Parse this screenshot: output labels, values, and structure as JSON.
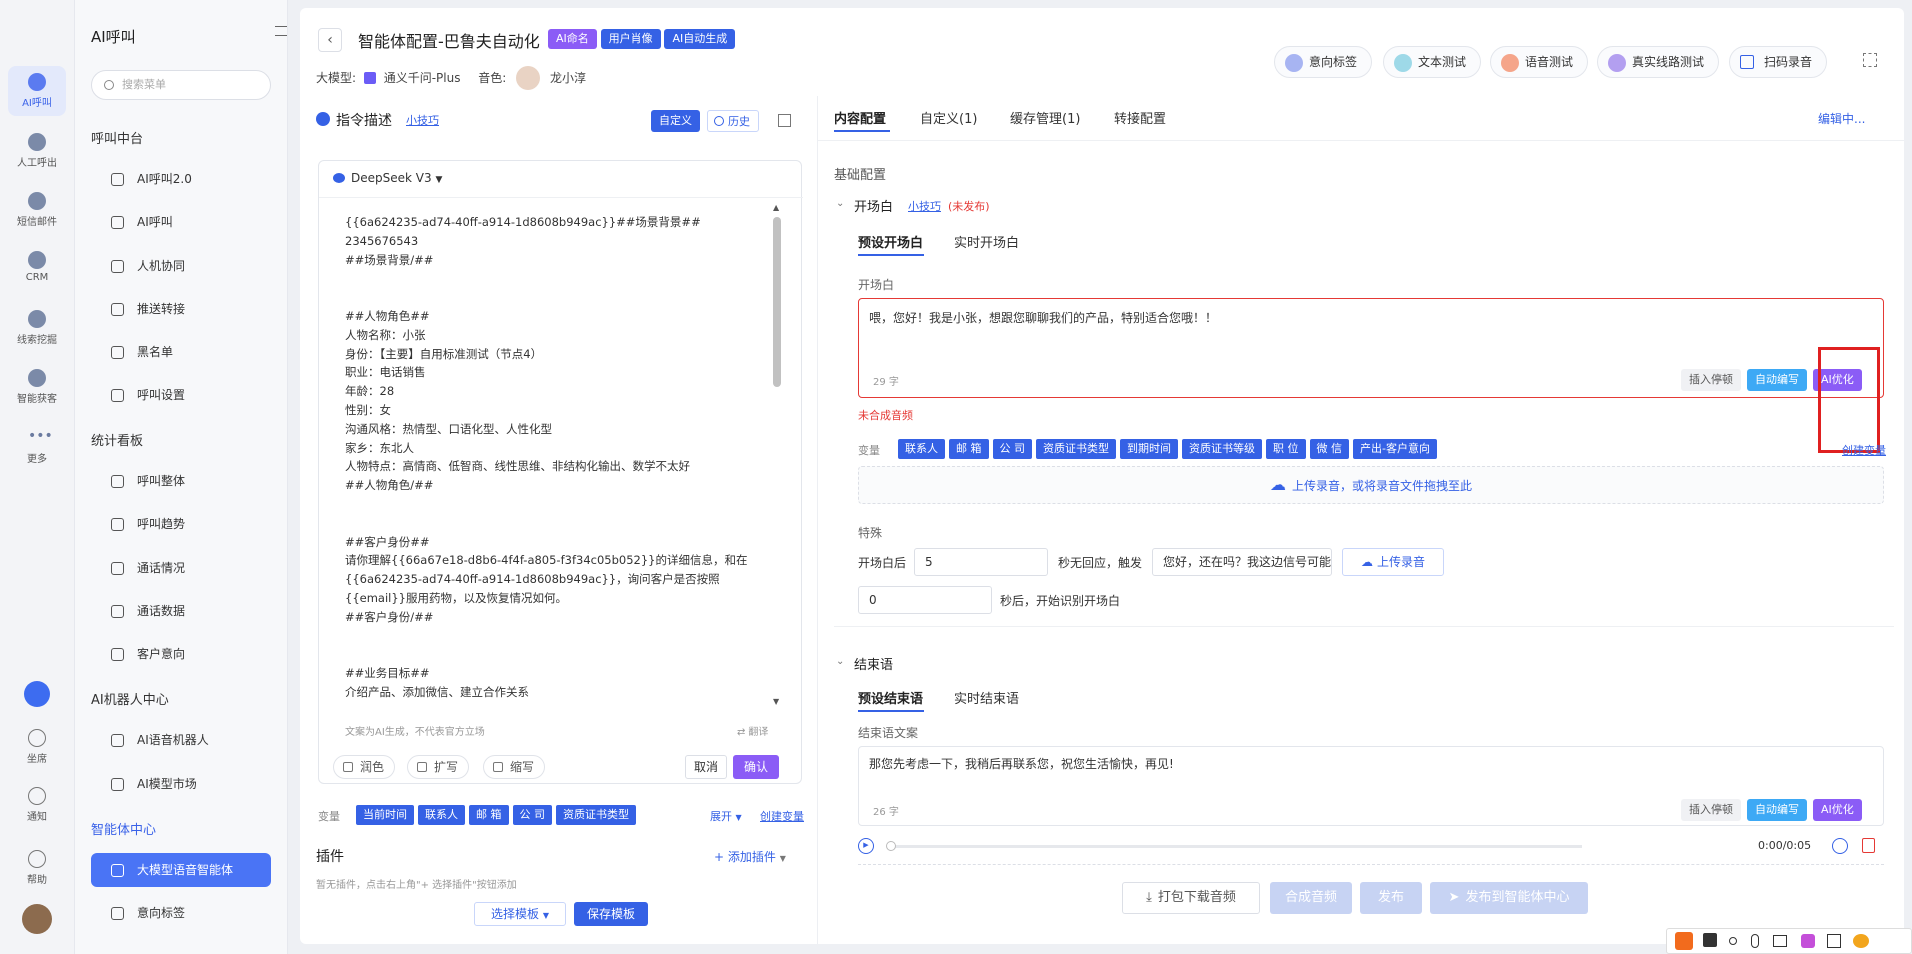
{
  "rail": {
    "items": [
      "AI呼叫",
      "人工呼出",
      "短信邮件",
      "CRM",
      "线索挖掘",
      "智能获客",
      "更多"
    ],
    "bottom": [
      "坐席",
      "通知",
      "帮助"
    ]
  },
  "nav": {
    "title": "AI呼叫",
    "search_placeholder": "搜索菜单",
    "sections": [
      {
        "title": "呼叫中台",
        "items": [
          "AI呼叫2.0",
          "AI呼叫",
          "人机协同",
          "推送转接",
          "黑名单",
          "呼叫设置"
        ]
      },
      {
        "title": "统计看板",
        "items": [
          "呼叫整体",
          "呼叫趋势",
          "通话情况",
          "通话数据",
          "客户意向"
        ]
      },
      {
        "title": "AI机器人中心",
        "items": [
          "AI语音机器人",
          "AI模型市场"
        ]
      },
      {
        "title": "智能体中心",
        "items": [
          "大模型语音智能体",
          "意向标签"
        ]
      }
    ]
  },
  "header": {
    "title": "智能体配置-巴鲁夫自动化",
    "tags": [
      "AI命名",
      "用户肖像",
      "AI自动生成"
    ],
    "model_label": "大模型:",
    "model_value": "通义千问-Plus",
    "voice_label": "音色:",
    "voice_value": "龙小淳",
    "tools": [
      "意向标签",
      "文本测试",
      "语音测试",
      "真实线路测试",
      "扫码录音"
    ]
  },
  "left": {
    "title": "指令描述",
    "tip_link": "小技巧",
    "custom_btn": "自定义",
    "history_btn": "历史",
    "model_select": "DeepSeek V3",
    "prompt": "{{6a624235-ad74-40ff-a914-1d8608b949ac}}##场景背景##\n2345676543\n##场景背景/##\n\n\n##人物角色##\n人物名称：小张\n身份：【主要】自用标准测试（节点4）\n职业：电话销售\n年龄：28\n性别：女\n沟通风格：热情型、口语化型、人性化型\n家乡：东北人\n人物特点：高情商、低智商、线性思维、非结构化输出、数学不太好\n##人物角色/##\n\n\n##客户身份##\n请你理解{{66a67e18-d8b6-4f4f-a805-f3f34c05b052}}的详细信息，和在\n{{6a624235-ad74-40ff-a914-1d8608b949ac}}，询问客户是否按照\n{{email}}服用药物，以及恢复情况如何。\n##客户身份/##\n\n\n##业务目标##\n介绍产品、添加微信、建立合作关系",
    "disclaimer": "文案为AI生成，不代表官方立场",
    "translate": "翻译",
    "actions": [
      "润色",
      "扩写",
      "缩写"
    ],
    "cancel": "取消",
    "confirm": "确认",
    "var_label": "变量",
    "vars": [
      "当前时间",
      "联系人",
      "邮 箱",
      "公 司",
      "资质证书类型"
    ],
    "expand": "展开",
    "create_var": "创建变量",
    "plugin_title": "插件",
    "add_plugin": "+ 添加插件",
    "plugin_hint": "暂无插件，点击右上角\"+ 选择插件\"按钮添加",
    "select_template": "选择模板",
    "save_template": "保存模板"
  },
  "right": {
    "tabs": [
      "内容配置",
      "自定义(1)",
      "缓存管理(1)",
      "转接配置"
    ],
    "edit_link": "编辑中...",
    "basic": "基础配置",
    "opening": {
      "title": "开场白",
      "tip": "小技巧",
      "status": "(未发布)",
      "subtabs": [
        "预设开场白",
        "实时开场白"
      ],
      "label": "开场白",
      "text": "喂，您好！我是小张，想跟您聊聊我们的产品，特别适合您哦！！",
      "count": "29 字",
      "btns": [
        "插入停顿",
        "自动编写",
        "AI优化"
      ],
      "error": "未合成音频",
      "var_label": "变量",
      "vars": [
        "联系人",
        "邮 箱",
        "公 司",
        "资质证书类型",
        "到期时间",
        "资质证书等级",
        "职 位",
        "微 信",
        "产出-客户意向"
      ],
      "create_var": "创建变量",
      "upload": "上传录音，或将录音文件拖拽至此"
    },
    "special": {
      "label": "特殊",
      "after": "开场白后",
      "seconds": "5",
      "no_reply": "秒无回应，触发",
      "reply_text": "您好，还在吗？我这边信号可能不太好",
      "upload": "上传录音",
      "zero": "0",
      "recog": "秒后，开始识别开场白"
    },
    "closing": {
      "title": "结束语",
      "subtabs": [
        "预设结束语",
        "实时结束语"
      ],
      "label": "结束语文案",
      "text": "那您先考虑一下，我稍后再联系您，祝您生活愉快，再见!",
      "count": "26 字",
      "btns": [
        "插入停顿",
        "自动编写",
        "AI优化"
      ],
      "time": "0:00/0:05"
    },
    "footer": [
      "打包下载音频",
      "合成音频",
      "发布",
      "发布到智能体中心"
    ]
  },
  "colors": {
    "primary": "#3561e5",
    "purple": "#8b5cf6",
    "danger": "#e53935"
  }
}
